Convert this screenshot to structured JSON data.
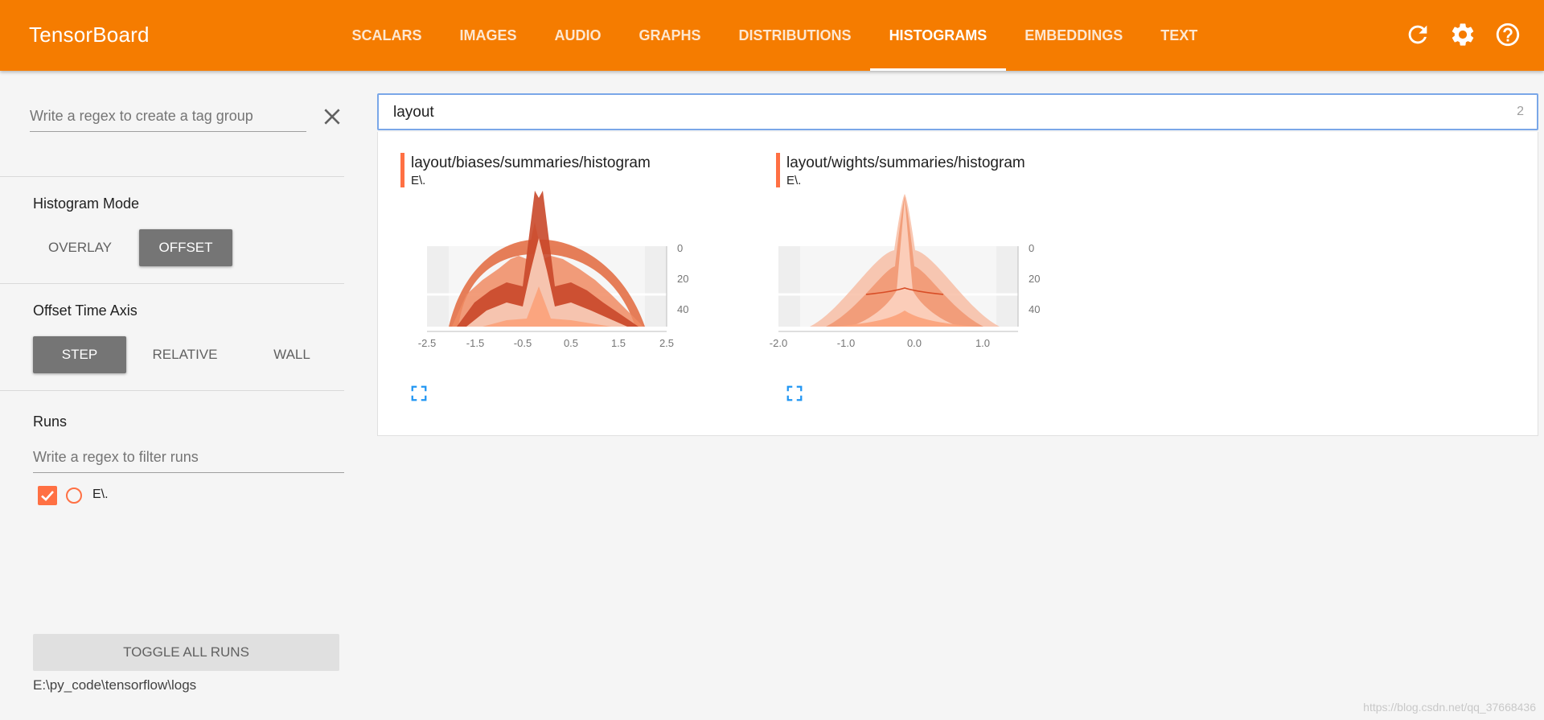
{
  "app": {
    "title": "TensorBoard"
  },
  "nav": {
    "tabs": [
      {
        "label": "SCALARS"
      },
      {
        "label": "IMAGES"
      },
      {
        "label": "AUDIO"
      },
      {
        "label": "GRAPHS"
      },
      {
        "label": "DISTRIBUTIONS"
      },
      {
        "label": "HISTOGRAMS",
        "active": true
      },
      {
        "label": "EMBEDDINGS"
      },
      {
        "label": "TEXT"
      }
    ],
    "icons": [
      "refresh-icon",
      "settings-icon",
      "help-icon"
    ]
  },
  "colors": {
    "accent": "#f57c00",
    "run": "#ff7043",
    "expand": "#2196f3"
  },
  "sidebar": {
    "tag_group_placeholder": "Write a regex to create a tag group",
    "histogram_mode": {
      "title": "Histogram Mode",
      "options": [
        "OVERLAY",
        "OFFSET"
      ],
      "selected": "OFFSET"
    },
    "offset_axis": {
      "title": "Offset Time Axis",
      "options": [
        "STEP",
        "RELATIVE",
        "WALL"
      ],
      "selected": "STEP"
    },
    "runs": {
      "title": "Runs",
      "filter_placeholder": "Write a regex to filter runs",
      "items": [
        {
          "label": "E\\.",
          "checked": true
        }
      ]
    },
    "toggle_all": "TOGGLE ALL RUNS",
    "logdir": "E:\\py_code\\tensorflow\\logs"
  },
  "main": {
    "filter_value": "layout",
    "filter_count": "2",
    "cards": [
      {
        "title": "layout/biases/summaries/histogram",
        "run": "E\\.",
        "x_ticks": [
          "-2.5",
          "-1.5",
          "-0.5",
          "0.5",
          "1.5",
          "2.5"
        ],
        "y_ticks": [
          "0",
          "20",
          "40"
        ]
      },
      {
        "title": "layout/wights/summaries/histogram",
        "run": "E\\.",
        "x_ticks": [
          "-2.0",
          "-1.0",
          "0.0",
          "1.0"
        ],
        "y_ticks": [
          "0",
          "20",
          "40"
        ]
      }
    ]
  },
  "watermark": "https://blog.csdn.net/qq_37668436"
}
